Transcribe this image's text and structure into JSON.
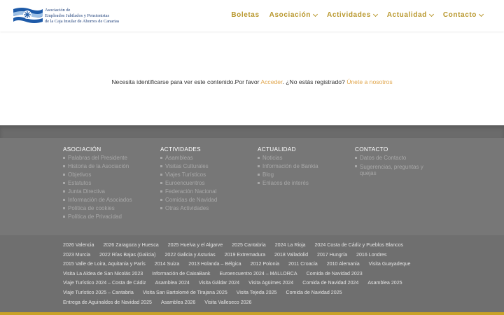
{
  "logo": {
    "line1": "Asociación de",
    "line2": "Empleados Jubilados y Pensionistas",
    "line3": "de la Caja Insular de Ahorros de Canarias",
    "colors": {
      "blue": "#1d5aa8",
      "light": "#9ec1e6"
    }
  },
  "nav": [
    {
      "label": "Boletas",
      "has_dropdown": false
    },
    {
      "label": "Asociación",
      "has_dropdown": true
    },
    {
      "label": "Actividades",
      "has_dropdown": true
    },
    {
      "label": "Actualidad",
      "has_dropdown": true
    },
    {
      "label": "Contacto",
      "has_dropdown": true
    }
  ],
  "main": {
    "message_prefix": "Necesita identificarse para ver este contenido.Por favor ",
    "login_link": "Acceder",
    "message_middle": ". ¿No estás registrado? ",
    "register_link": "Únete a nosotros"
  },
  "footer": {
    "columns": [
      {
        "title": "ASOCIACIÓN",
        "items": [
          "Palabras del Presidente",
          "Historia de la Asociación",
          "Objetivos",
          "Estatutos",
          "Junta Directiva",
          "Información de Asociados",
          "Política de cookies",
          "Política de Privacidad"
        ]
      },
      {
        "title": "ACTIVIDADES",
        "items": [
          "Asambleas",
          "Visitas Culturales",
          "Viajes Turísticos",
          "Euroencuentros",
          "Federación Nacional",
          "Comidas de Navidad",
          "Otras Actividades"
        ]
      },
      {
        "title": "ACTUALIDAD",
        "items": [
          "Noticias",
          "Información de Bankia",
          "Blog",
          "Enlaces de interés"
        ]
      },
      {
        "title": "CONTACTO",
        "items": [
          "Datos de Contacto",
          "Sugerencias, preguntas y quejas"
        ]
      }
    ],
    "tags": [
      "2026 Valencia",
      "2026 Zaragoza y Huesca",
      "2025 Huelva y el Algarve",
      "2025 Cantabria",
      "2024 La Rioja",
      "2024 Costa de Cádiz y Pueblos Blancos",
      "2023 Murcia",
      "2022 Rías Bajas (Galicia)",
      "2022 Galicia y Asturias",
      "2019 Extremadura",
      "2018 Valladolid",
      "2017 Hungría",
      "2016 Londres",
      "2015 Valle de Loira, Aquitania y París",
      "2014 Suiza",
      "2013 Holanda – Bélgica",
      "2012 Polonia",
      "2011 Croacia",
      "2010 Alemania",
      "Visita Guayadeque",
      "Visita La Aldea de San Nicolás 2023",
      "Información de CaixaBank",
      "Euroencuentro 2024 – MALLORCA",
      "Comida de Navidad 2023",
      "Viaje Turístico 2024 – Costa de Cádiz",
      "Asamblea 2024",
      "Visita Gáldar 2024",
      "Visita Agüimes 2024",
      "Comida de Navidad 2024",
      "Asamblea 2025",
      "Viaje Turístico 2025 – Cantabria",
      "Visita San Bartolomé de Tirajana 2025",
      "Visita Tejeda 2025",
      "Comida de Navidad 2025",
      "Entrega de Aguinaldos de Navidad 2025",
      "Asamblea 2026",
      "Visita Valleseco 2026"
    ]
  }
}
